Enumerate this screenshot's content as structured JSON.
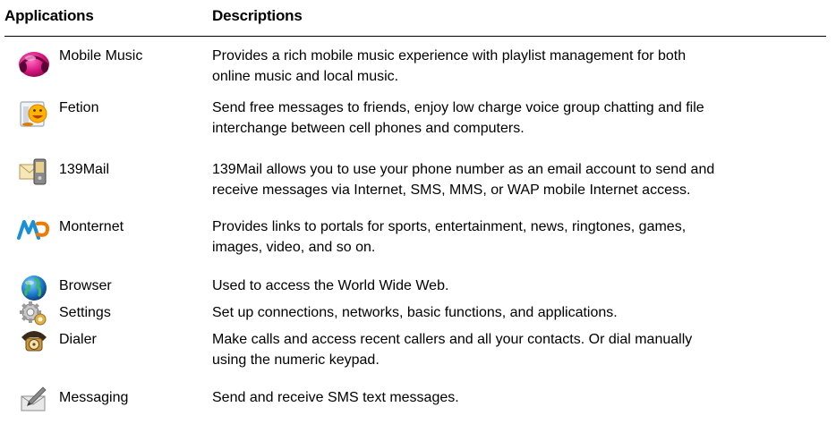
{
  "header": {
    "applications": "Applications",
    "descriptions": "Descriptions"
  },
  "rows": [
    {
      "icon": "mobile-music-icon",
      "name": "Mobile Music",
      "desc_lines": [
        "Provides a rich mobile music experience with playlist management for both",
        "online music and local music."
      ]
    },
    {
      "icon": "fetion-icon",
      "name": "Fetion",
      "desc_lines": [
        "Send free messages to friends, enjoy low charge voice group chatting and file",
        "interchange between cell phones and computers."
      ]
    },
    {
      "icon": "139mail-icon",
      "name": "139Mail",
      "desc_lines": [
        "139Mail allows you to use your phone number as an email account to send and",
        "receive messages via Internet, SMS, MMS, or WAP mobile Internet access."
      ]
    },
    {
      "icon": "monternet-icon",
      "name": "Monternet",
      "desc_lines": [
        "Provides links to portals for sports, entertainment, news, ringtones, games,",
        "images, video, and so on."
      ]
    },
    {
      "icon": "browser-icon",
      "name": "Browser",
      "desc_lines": [
        "Used to access the World Wide Web."
      ]
    },
    {
      "icon": "settings-icon",
      "name": "Settings",
      "desc_lines": [
        "Set up connections, networks, basic functions, and applications."
      ]
    },
    {
      "icon": "dialer-icon",
      "name": "Dialer",
      "desc_lines": [
        "Make calls and access recent callers and all your contacts. Or dial manually",
        "using the numeric keypad."
      ]
    },
    {
      "icon": "messaging-icon",
      "name": "Messaging",
      "desc_lines": [
        "Send and receive SMS text messages."
      ]
    }
  ]
}
